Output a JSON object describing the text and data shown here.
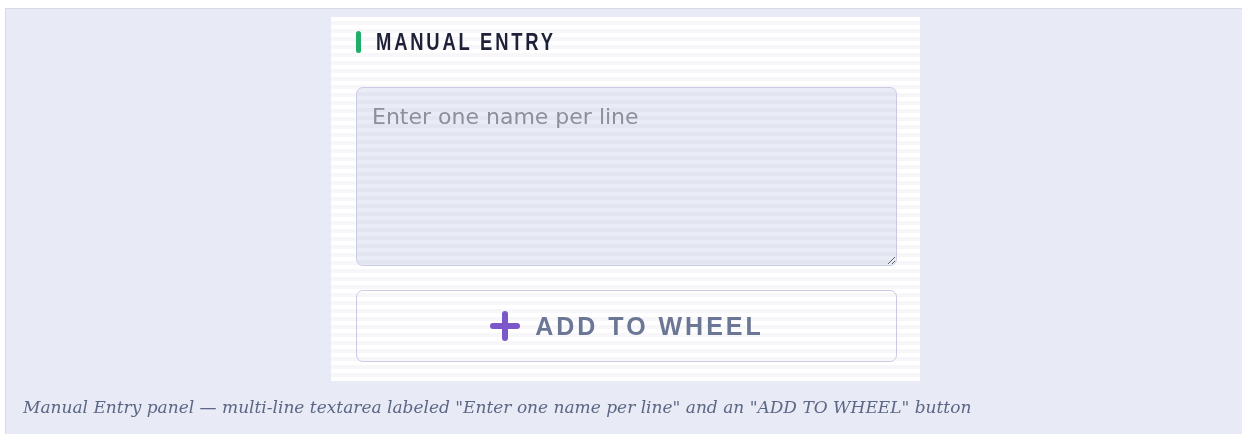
{
  "panel": {
    "title": "MANUAL ENTRY",
    "textarea": {
      "placeholder": "Enter one name per line"
    },
    "button": {
      "label": "ADD TO WHEEL"
    }
  },
  "caption": "Manual Entry panel — multi-line textarea labeled \"Enter one name per line\" and an \"ADD TO WHEEL\" button"
}
